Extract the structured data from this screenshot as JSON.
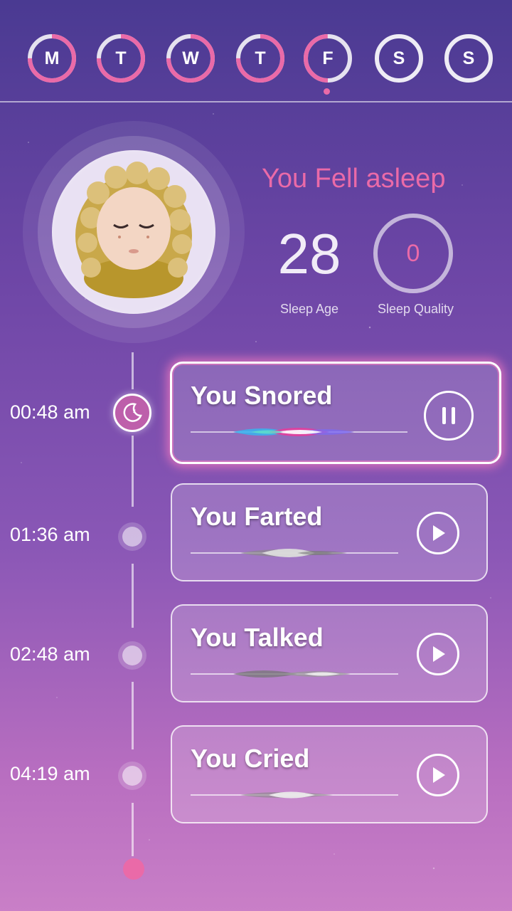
{
  "days": [
    {
      "label": "M",
      "progress": 0.75
    },
    {
      "label": "T",
      "progress": 0.75
    },
    {
      "label": "W",
      "progress": 0.75
    },
    {
      "label": "T",
      "progress": 0.75
    },
    {
      "label": "F",
      "progress": 0.5,
      "selected": true
    },
    {
      "label": "S",
      "progress": 0
    },
    {
      "label": "S",
      "progress": 0
    }
  ],
  "summary": {
    "title": "You Fell asleep",
    "sleep_age": "28",
    "sleep_age_label": "Sleep Age",
    "sleep_quality": "0",
    "sleep_quality_label": "Sleep Quality"
  },
  "events": [
    {
      "time": "00:48 am",
      "title": "You Snored",
      "state": "playing"
    },
    {
      "time": "01:36 am",
      "title": "You Farted",
      "state": "paused"
    },
    {
      "time": "02:48 am",
      "title": "You Talked",
      "state": "paused"
    },
    {
      "time": "04:19 am",
      "title": "You Cried",
      "state": "paused"
    }
  ],
  "colors": {
    "accent": "#ea6aa8",
    "bg_top": "#4a3a92",
    "bg_bottom": "#c97fc7"
  },
  "icons": {
    "active_node": "moon-icon",
    "pause": "pause-icon",
    "play": "play-icon"
  }
}
